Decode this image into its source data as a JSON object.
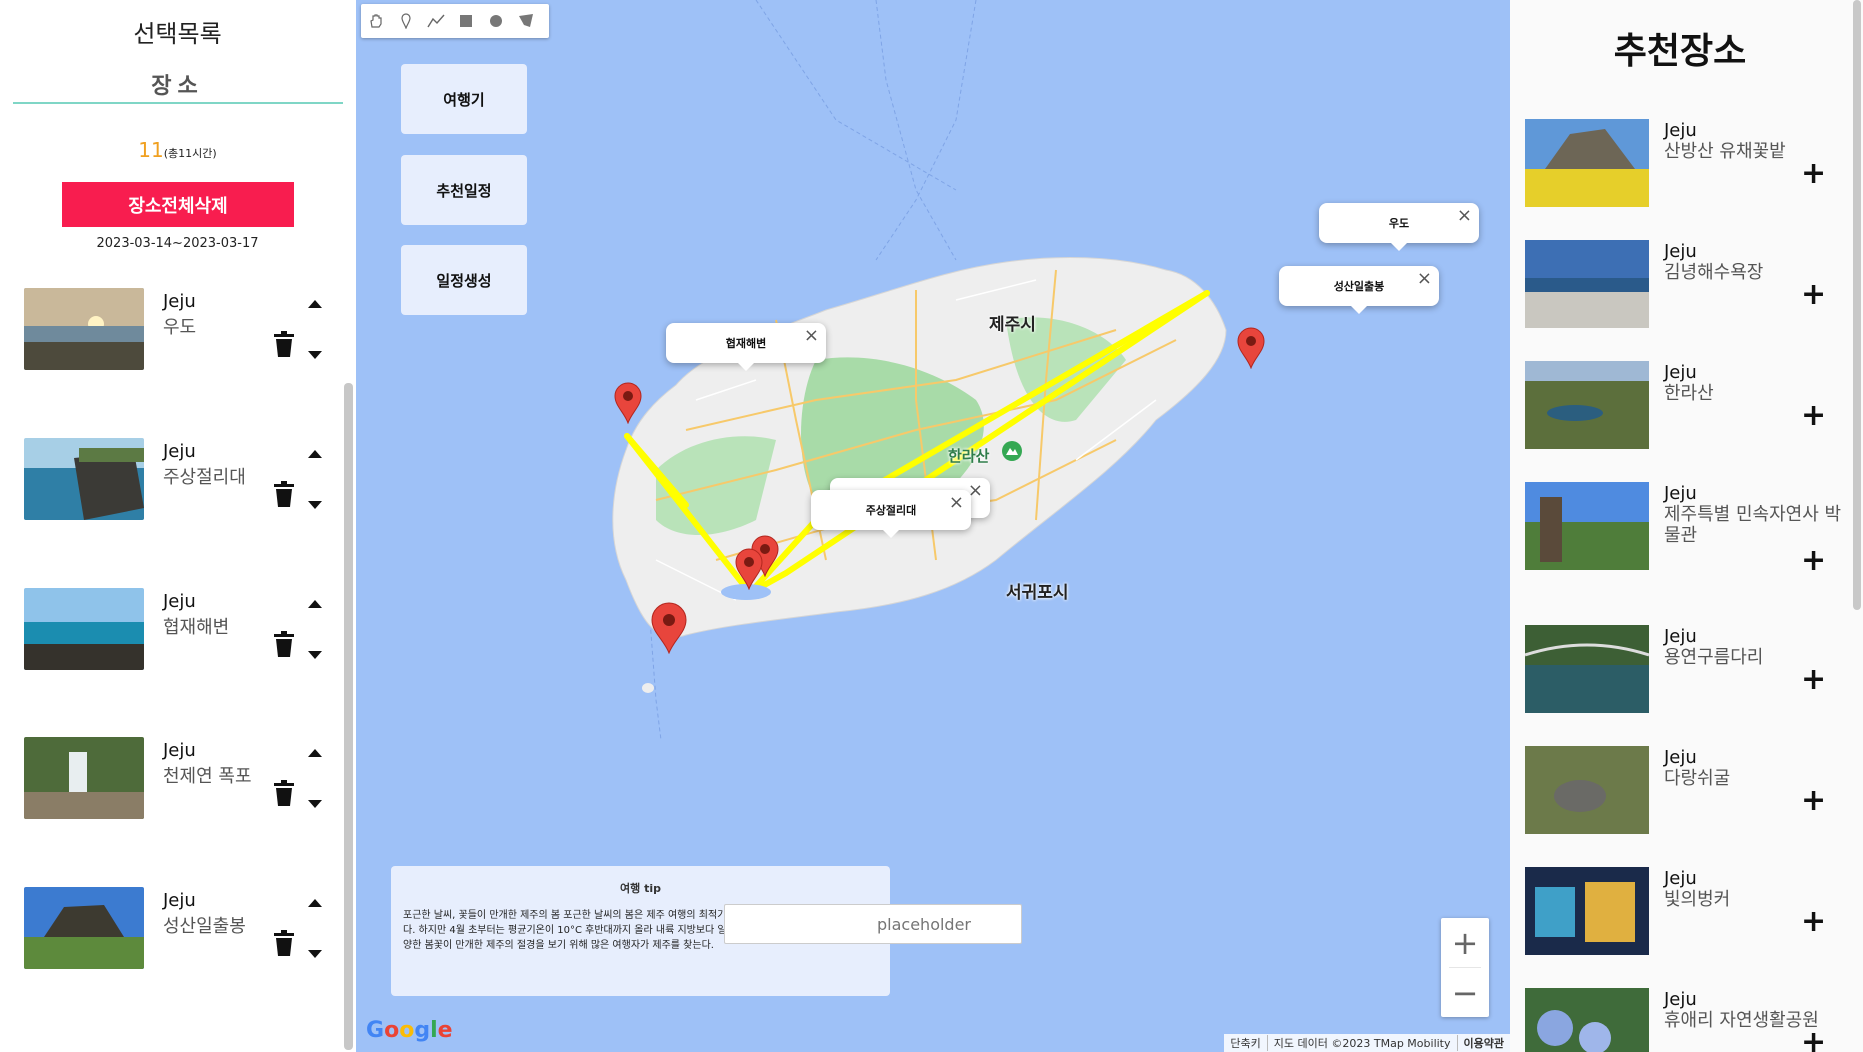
{
  "left_panel": {
    "title": "선택목록",
    "tab": "장소",
    "hours": "11",
    "hours_detail": "(총11시간)",
    "delete_all_label": "장소전체삭제",
    "date_range": "2023-03-14~2023-03-17",
    "items": [
      {
        "region": "Jeju",
        "name": "우도"
      },
      {
        "region": "Jeju",
        "name": "주상절리대"
      },
      {
        "region": "Jeju",
        "name": "협재해변"
      },
      {
        "region": "Jeju",
        "name": "천제연 폭포"
      },
      {
        "region": "Jeju",
        "name": "성산일출봉"
      }
    ]
  },
  "map": {
    "buttons": {
      "travel": "여행기",
      "recommended": "추천일정",
      "create": "일정생성"
    },
    "tools": [
      "hand-icon",
      "marker-icon",
      "polyline-icon",
      "rectangle-icon",
      "circle-icon",
      "polygon-icon"
    ],
    "info_windows": {
      "udo": "우도",
      "seongsan": "성산일출봉",
      "hyeopjae": "협재해변",
      "jusang": "주상절리대"
    },
    "cities": {
      "jeju": "제주시",
      "seogwipo": "서귀포시",
      "hallasan": "한라산"
    },
    "tip": {
      "title": "여행 tip",
      "body": "포근한 날씨, 꽃들이 만개한 제주의 봄 포근한 날씨의 봄은 제주 여행의 최적기. 3월까지는 꽃샘추위로 추울 수 있다. 하지만 4월 초부터는 평균기온이 10°C 후반대까지 올라 내륙 지방보다 일찍 봄꽃이 핀다. 유채꽃, 벚꽃 등 다양한 봄꽃이 만개한 제주의 절경을 보기 위해 많은 여행자가 제주를 찾는다."
    },
    "search_placeholder": "placeholder",
    "google_label": "Google",
    "attribution": {
      "shortcut": "단축키",
      "data": "지도 데이터 ©2023 TMap Mobility",
      "terms": "이용약관"
    },
    "colors": {
      "water": "#9ec1f7",
      "route": "#ffff00",
      "marker": "#e8453c"
    }
  },
  "right_panel": {
    "title": "추천장소",
    "items": [
      {
        "region": "Jeju",
        "name": "산방산 유채꽃밭"
      },
      {
        "region": "Jeju",
        "name": "김녕해수욕장"
      },
      {
        "region": "Jeju",
        "name": "한라산"
      },
      {
        "region": "Jeju",
        "name": "제주특별 민속자연사 박물관"
      },
      {
        "region": "Jeju",
        "name": "용연구름다리"
      },
      {
        "region": "Jeju",
        "name": "다랑쉬굴"
      },
      {
        "region": "Jeju",
        "name": "빛의벙커"
      },
      {
        "region": "Jeju",
        "name": "휴애리 자연생활공원"
      }
    ]
  }
}
